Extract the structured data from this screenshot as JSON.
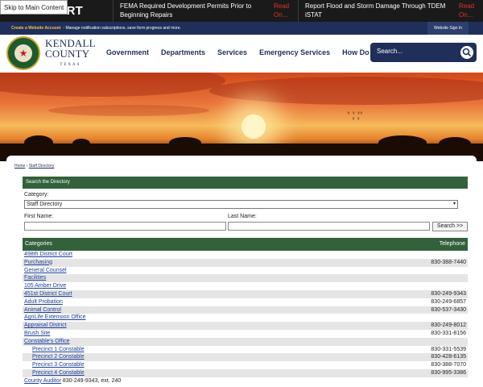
{
  "alert": {
    "title": "ENCY ALERT",
    "skip_label": "Skip to Main Content",
    "items": [
      {
        "text": "FEMA Required Development Permits Prior to Beginning Repairs",
        "more": "Read On..."
      },
      {
        "text": "Report Flood and Storm Damage Through TDEM iSTAT",
        "more": "Read On..."
      }
    ]
  },
  "account": {
    "create_label": "Create a Website Account",
    "tagline": "- Manage notification subscriptions, save form progress and more.",
    "signin_label": "Website Sign In"
  },
  "header": {
    "county_line1": "KENDALL",
    "county_line2": "COUNTY",
    "state": "TEXAS",
    "nav": [
      "Government",
      "Departments",
      "Services",
      "Emergency Services",
      "How Do I..."
    ],
    "search_placeholder": "Search..."
  },
  "breadcrumb": {
    "home": "Home",
    "separator": "›",
    "current": "Staff Directory"
  },
  "directory": {
    "search_title": "Search the Directory",
    "category_label": "Category:",
    "category_value": "Staff Directory",
    "first_name_label": "First Name:",
    "last_name_label": "Last Name:",
    "search_button": "Search >>",
    "col_categories": "Categories",
    "col_telephone": "Telephone",
    "rows": [
      {
        "name": "498th District Court",
        "phone": "",
        "sub": false
      },
      {
        "name": "Purchasing",
        "phone": "830-388-7440",
        "sub": false
      },
      {
        "name": "General Counsel",
        "phone": "",
        "sub": false
      },
      {
        "name": "Facilities",
        "phone": "",
        "sub": false
      },
      {
        "name": "105 Amber Drive",
        "phone": "",
        "sub": false
      },
      {
        "name": "451st District Court",
        "phone": "830-249-9343",
        "sub": false
      },
      {
        "name": "Adult Probation",
        "phone": "830-249-6857",
        "sub": false
      },
      {
        "name": "Animal Control",
        "phone": "830-537-3430",
        "sub": false
      },
      {
        "name": "AgriLife Extension Office",
        "phone": "",
        "sub": false
      },
      {
        "name": "Appraisal District",
        "phone": "830-249-8012",
        "sub": false
      },
      {
        "name": "Brush Site",
        "phone": "830-331-8156",
        "sub": false
      },
      {
        "name": "Constable's Office",
        "phone": "",
        "sub": false
      },
      {
        "name": "Precinct 1 Constable",
        "phone": "830-331-5539",
        "sub": true
      },
      {
        "name": "Precinct 2 Constable",
        "phone": "830-428-6135",
        "sub": true
      },
      {
        "name": "Precinct 3 Constable",
        "phone": "830-388-7070",
        "sub": true
      },
      {
        "name": "Precinct 4 Constable",
        "phone": "830-995-3386",
        "sub": true
      },
      {
        "name": "County Auditor",
        "extra": "830-249-9343, ext. 240",
        "phone": "",
        "sub": false
      }
    ]
  },
  "colors": {
    "navy": "#1f2f5a",
    "green": "#32613c",
    "alert_red": "#e0312b"
  }
}
